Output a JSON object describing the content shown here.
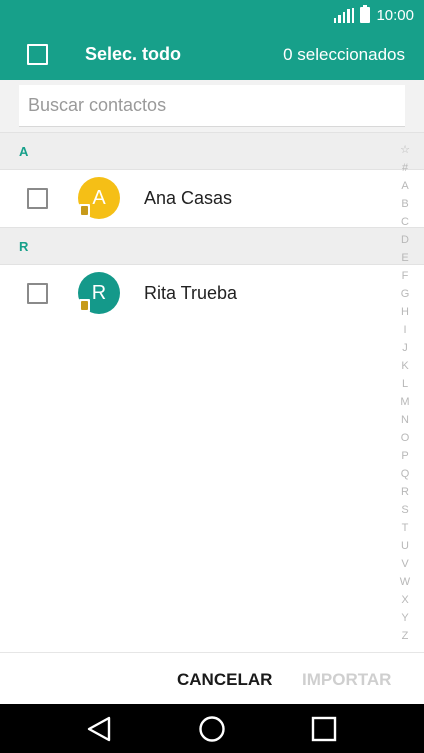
{
  "status_bar": {
    "time": "10:00"
  },
  "header": {
    "select_all_label": "Selec. todo",
    "selected_count": "0 seleccionados"
  },
  "search": {
    "placeholder": "Buscar contactos",
    "value": ""
  },
  "sections": [
    {
      "letter": "A",
      "contacts": [
        {
          "initial": "A",
          "name": "Ana Casas",
          "avatar_color": "#f5bf16"
        }
      ]
    },
    {
      "letter": "R",
      "contacts": [
        {
          "initial": "R",
          "name": "Rita Trueba",
          "avatar_color": "#14998a"
        }
      ]
    }
  ],
  "index_letters": [
    "☆",
    "#",
    "A",
    "B",
    "C",
    "D",
    "E",
    "F",
    "G",
    "H",
    "I",
    "J",
    "K",
    "L",
    "M",
    "N",
    "O",
    "P",
    "Q",
    "R",
    "S",
    "T",
    "U",
    "V",
    "W",
    "X",
    "Y",
    "Z"
  ],
  "footer": {
    "cancel_label": "CANCELAR",
    "import_label": "IMPORTAR"
  },
  "colors": {
    "accent": "#17a08a",
    "disabled": "#cfcfcf"
  },
  "icons": {
    "signal": "signal-icon",
    "battery": "battery-icon",
    "back": "back-icon",
    "home": "home-icon",
    "recents": "recents-icon",
    "sim": "sim-card-icon"
  }
}
